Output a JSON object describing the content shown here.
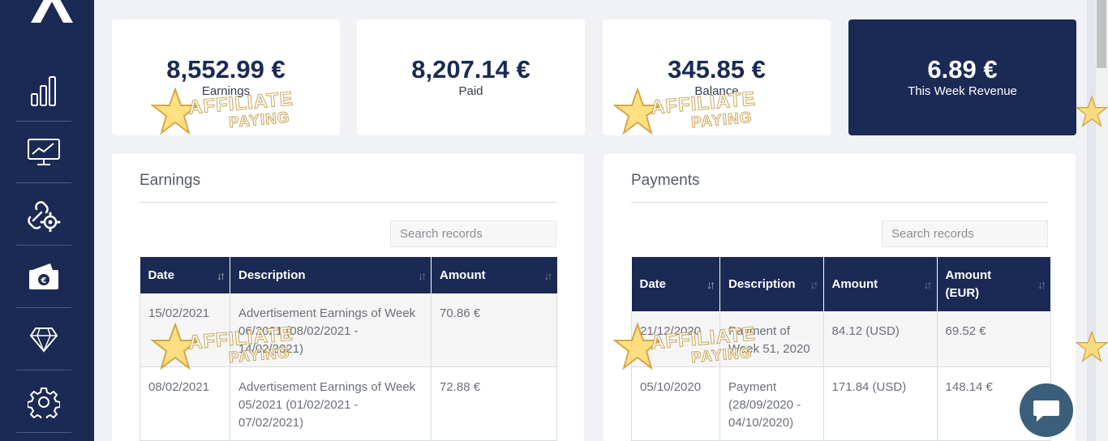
{
  "stats": [
    {
      "value": "8,552.99 €",
      "label": "Earnings"
    },
    {
      "value": "8,207.14 €",
      "label": "Paid"
    },
    {
      "value": "345.85 €",
      "label": "Balance"
    },
    {
      "value": "6.89 €",
      "label": "This Week Revenue"
    }
  ],
  "earnings": {
    "title": "Earnings",
    "search_placeholder": "Search records",
    "columns": [
      "Date",
      "Description",
      "Amount"
    ],
    "rows": [
      {
        "date": "15/02/2021",
        "description": "Advertisement Earnings of Week 06/2021 (08/02/2021 - 14/02/2021)",
        "amount": "70.86 €"
      },
      {
        "date": "08/02/2021",
        "description": "Advertisement Earnings of Week 05/2021 (01/02/2021 - 07/02/2021)",
        "amount": "72.88 €"
      }
    ]
  },
  "payments": {
    "title": "Payments",
    "search_placeholder": "Search records",
    "columns": [
      "Date",
      "Description",
      "Amount",
      "Amount (EUR)"
    ],
    "rows": [
      {
        "date": "21/12/2020",
        "description": "Payment of Week 51, 2020",
        "amount": "84.12 (USD)",
        "amount_eur": "69.52 €"
      },
      {
        "date": "05/10/2020",
        "description": "Payment (28/09/2020 - 04/10/2020)",
        "amount": "171.84 (USD)",
        "amount_eur": "148.14 €"
      }
    ]
  },
  "watermark": {
    "line1": "AFFILIATE",
    "line2": "PAYING"
  },
  "icons": [
    "logo-icon",
    "bar-chart-icon",
    "monitor-chart-icon",
    "link-gear-icon",
    "euro-wallet-icon",
    "diamond-icon",
    "gear-icon",
    "chat-icon"
  ],
  "colors": {
    "navy": "#1b2a55",
    "panel": "#ffffff",
    "bg": "#f0f2f5",
    "chat": "#3b5f7a"
  }
}
